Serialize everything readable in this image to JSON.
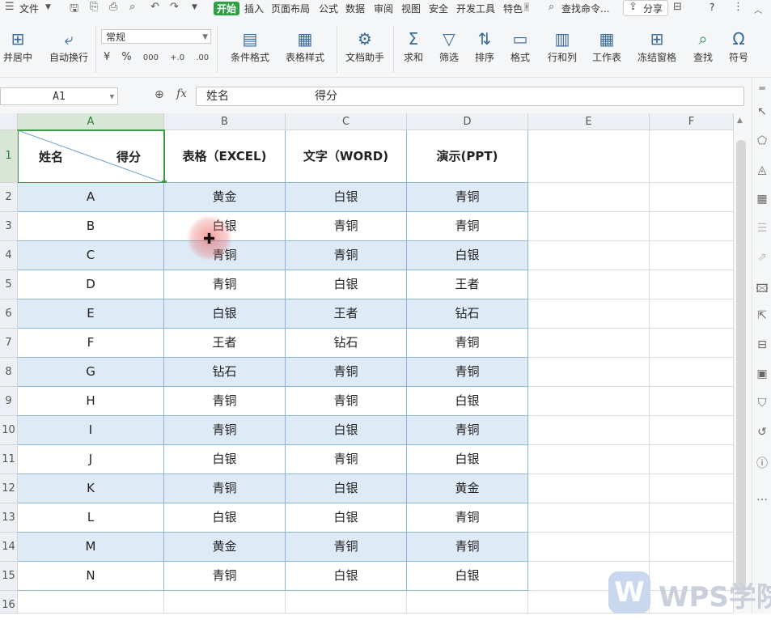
{
  "menu": {
    "file": "文件",
    "start": "开始",
    "items": [
      "插入",
      "页面布局",
      "公式",
      "数据",
      "审阅",
      "视图",
      "安全",
      "开发工具",
      "特色"
    ],
    "search": "查找命令...",
    "share": "分享",
    "help": "?"
  },
  "ribbon": {
    "merge_center": "并居中",
    "auto_wrap": "自动换行",
    "number_format": "常规",
    "currency_icon": "¥",
    "percent": "%",
    "thousands": "000",
    "inc_decimal": "+.0",
    "dec_decimal": ".00",
    "conditional_format": "条件格式",
    "table_style": "表格样式",
    "doc_helper": "文档助手",
    "sum": "求和",
    "filter": "筛选",
    "sort": "排序",
    "format": "格式",
    "row_col": "行和列",
    "worksheet": "工作表",
    "freeze": "冻结窗格",
    "find": "查找",
    "symbol": "符号"
  },
  "formula_bar": {
    "name_box": "A1",
    "fx": "fx",
    "content_1": "姓名",
    "content_2": "得分"
  },
  "columns": [
    "A",
    "B",
    "C",
    "D",
    "E",
    "F"
  ],
  "rows": [
    "1",
    "2",
    "3",
    "4",
    "5",
    "6",
    "7",
    "8",
    "9",
    "10",
    "11",
    "12",
    "13",
    "14",
    "15",
    "16"
  ],
  "table": {
    "header_a_left": "姓名",
    "header_a_right": "得分",
    "headers": [
      "表格（EXCEL)",
      "文字（WORD)",
      "演示(PPT)"
    ],
    "data": [
      [
        "A",
        "黄金",
        "白银",
        "青铜"
      ],
      [
        "B",
        "白银",
        "青铜",
        "青铜"
      ],
      [
        "C",
        "青铜",
        "青铜",
        "白银"
      ],
      [
        "D",
        "青铜",
        "白银",
        "王者"
      ],
      [
        "E",
        "白银",
        "王者",
        "钻石"
      ],
      [
        "F",
        "王者",
        "钻石",
        "青铜"
      ],
      [
        "G",
        "钻石",
        "青铜",
        "青铜"
      ],
      [
        "H",
        "青铜",
        "青铜",
        "白银"
      ],
      [
        "I",
        "青铜",
        "白银",
        "青铜"
      ],
      [
        "J",
        "白银",
        "青铜",
        "白银"
      ],
      [
        "K",
        "青铜",
        "白银",
        "黄金"
      ],
      [
        "L",
        "白银",
        "白银",
        "青铜"
      ],
      [
        "M",
        "黄金",
        "青铜",
        "青铜"
      ],
      [
        "N",
        "青铜",
        "白银",
        "白银"
      ]
    ]
  },
  "watermark": {
    "mark": "W",
    "text": "WPS学院"
  }
}
